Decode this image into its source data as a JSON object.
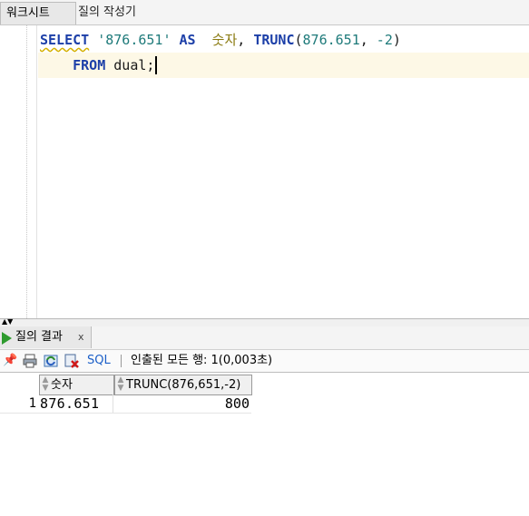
{
  "tabs": {
    "worksheet": "워크시트",
    "query_builder": "질의 작성기"
  },
  "editor": {
    "line1": {
      "kw_select": "SELECT",
      "str_value": "'876.651'",
      "kw_as": "AS",
      "alias": "숫자",
      "comma1": ",",
      "func": "TRUNC",
      "paren_open": "(",
      "arg1": "876.651",
      "comma2": ",",
      "arg2": "-2",
      "paren_close": ")"
    },
    "line2": {
      "kw_from": "FROM",
      "table": "dual;"
    }
  },
  "results": {
    "tab_label": "질의 결과",
    "close_label": "x",
    "toolbar": {
      "pin_icon": "pin-icon",
      "print_icon": "print-icon",
      "refresh_icon": "refresh-icon",
      "export_icon": "export-icon",
      "sql_label": "SQL",
      "status": "인출된 모든 행: 1(0,003초)"
    },
    "columns": [
      "숫자",
      "TRUNC(876,651,-2)"
    ],
    "rows": [
      {
        "num": "1",
        "c1": "876.651",
        "c2": "800"
      }
    ]
  }
}
